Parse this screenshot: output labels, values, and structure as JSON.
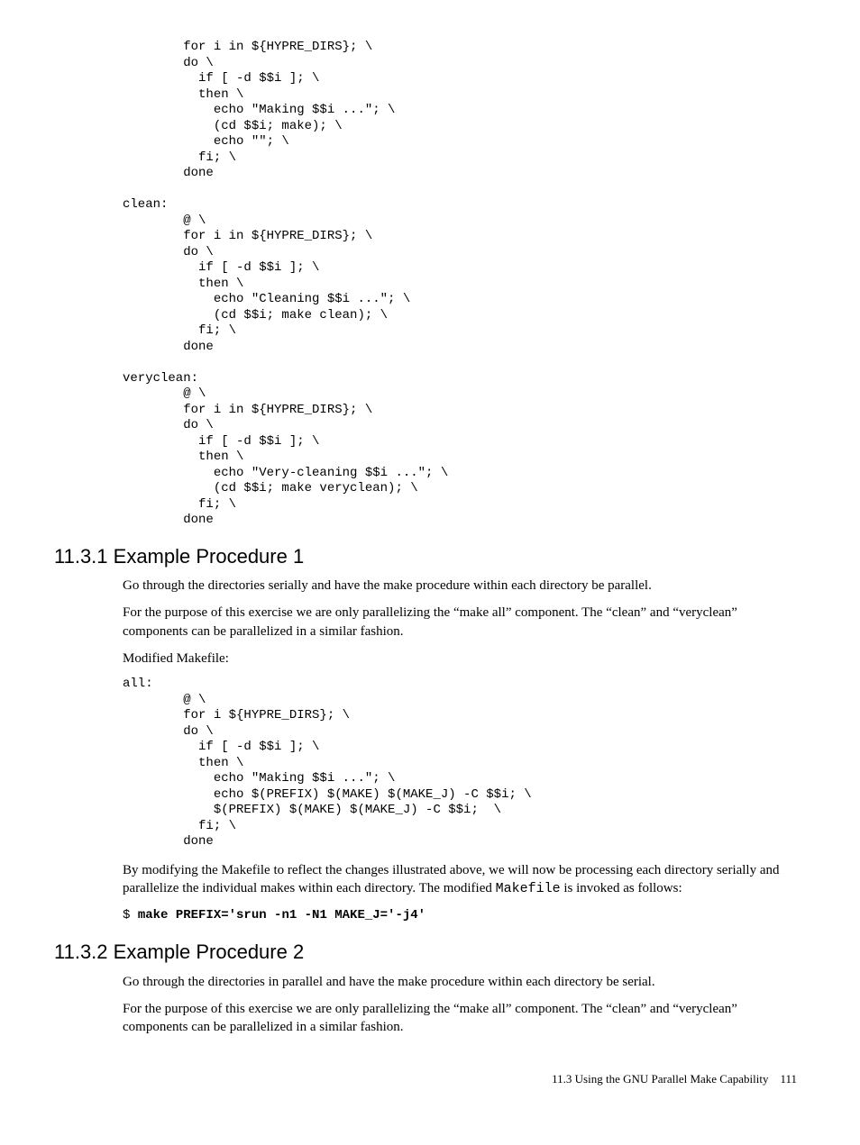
{
  "code1": "        for i in ${HYPRE_DIRS}; \\\n        do \\\n          if [ -d $$i ]; \\\n          then \\\n            echo \"Making $$i ...\"; \\\n            (cd $$i; make); \\\n            echo \"\"; \\\n          fi; \\\n        done\n\nclean:\n        @ \\\n        for i in ${HYPRE_DIRS}; \\\n        do \\\n          if [ -d $$i ]; \\\n          then \\\n            echo \"Cleaning $$i ...\"; \\\n            (cd $$i; make clean); \\\n          fi; \\\n        done\n\nveryclean:\n        @ \\\n        for i in ${HYPRE_DIRS}; \\\n        do \\\n          if [ -d $$i ]; \\\n          then \\\n            echo \"Very-cleaning $$i ...\"; \\\n            (cd $$i; make veryclean); \\\n          fi; \\\n        done",
  "h1": "11.3.1 Example Procedure 1",
  "p1": "Go through the directories serially and have the make procedure within each directory be parallel.",
  "p2": "For the purpose of this exercise we are only parallelizing the “make all” component. The “clean” and “veryclean” components can be parallelized in a similar fashion.",
  "p3": "Modified Makefile:",
  "code2": "all:\n        @ \\\n        for i ${HYPRE_DIRS}; \\\n        do \\\n          if [ -d $$i ]; \\\n          then \\\n            echo \"Making $$i ...\"; \\\n            echo $(PREFIX) $(MAKE) $(MAKE_J) -C $$i; \\\n            $(PREFIX) $(MAKE) $(MAKE_J) -C $$i;  \\\n          fi; \\\n        done",
  "p4a": "By modifying the Makefile to reflect the changes illustrated above, we will now be processing each directory serially and parallelize the individual makes within each directory. The modified ",
  "p4b": "Makefile",
  "p4c": " is invoked as follows:",
  "cmd_prompt": "$ ",
  "cmd_text": "make PREFIX='srun -n1 -N1 MAKE_J='-j4'",
  "h2": "11.3.2 Example Procedure 2",
  "p5": "Go through the directories in parallel and have the make procedure within each directory be serial.",
  "p6": "For the purpose of this exercise we are only parallelizing the “make all” component. The “clean” and “veryclean” components can be parallelized in a similar fashion.",
  "footer": "11.3 Using the GNU Parallel Make Capability 111"
}
